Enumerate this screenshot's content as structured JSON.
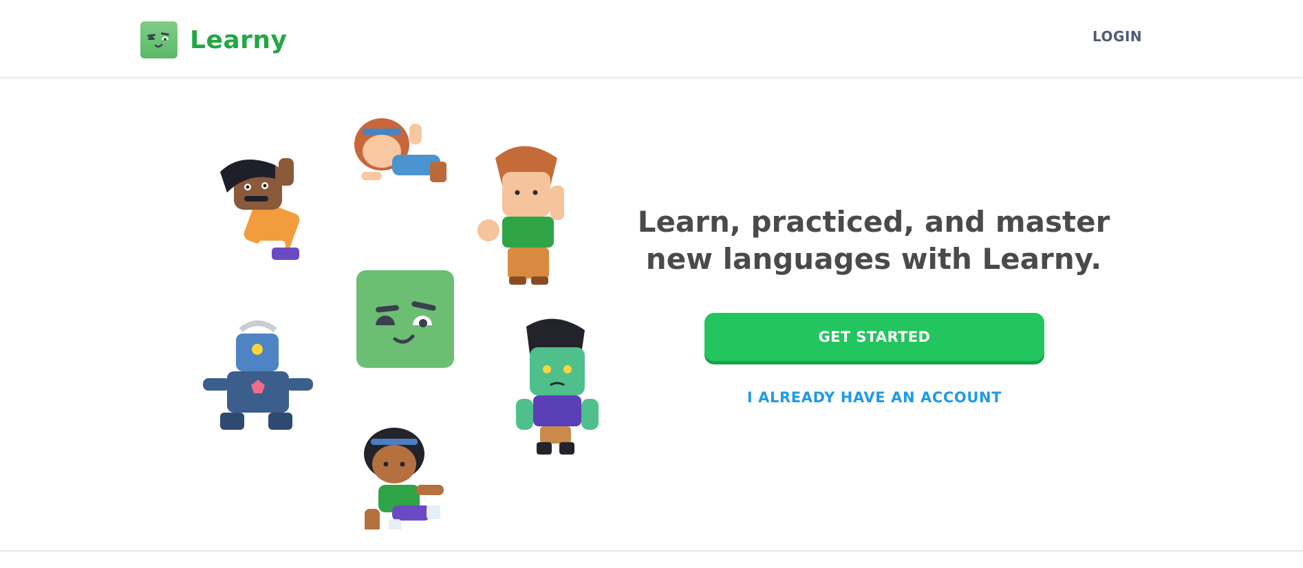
{
  "header": {
    "brand": "Learny",
    "login_label": "LOGIN"
  },
  "hero": {
    "title": "Learn, practiced, and master new languages with Learny.",
    "primary_button": "GET STARTED",
    "secondary_link": "I ALREADY HAVE AN ACCOUNT"
  },
  "colors": {
    "brand_green": "#22a744",
    "button_green": "#22c55e",
    "link_blue": "#1e9be6",
    "text_dark": "#4a4a4a"
  },
  "illustration": {
    "characters": [
      "mustache-man",
      "red-hair-girl",
      "ginger-boy",
      "mascot-face",
      "robot",
      "zombie",
      "headband-girl"
    ]
  }
}
